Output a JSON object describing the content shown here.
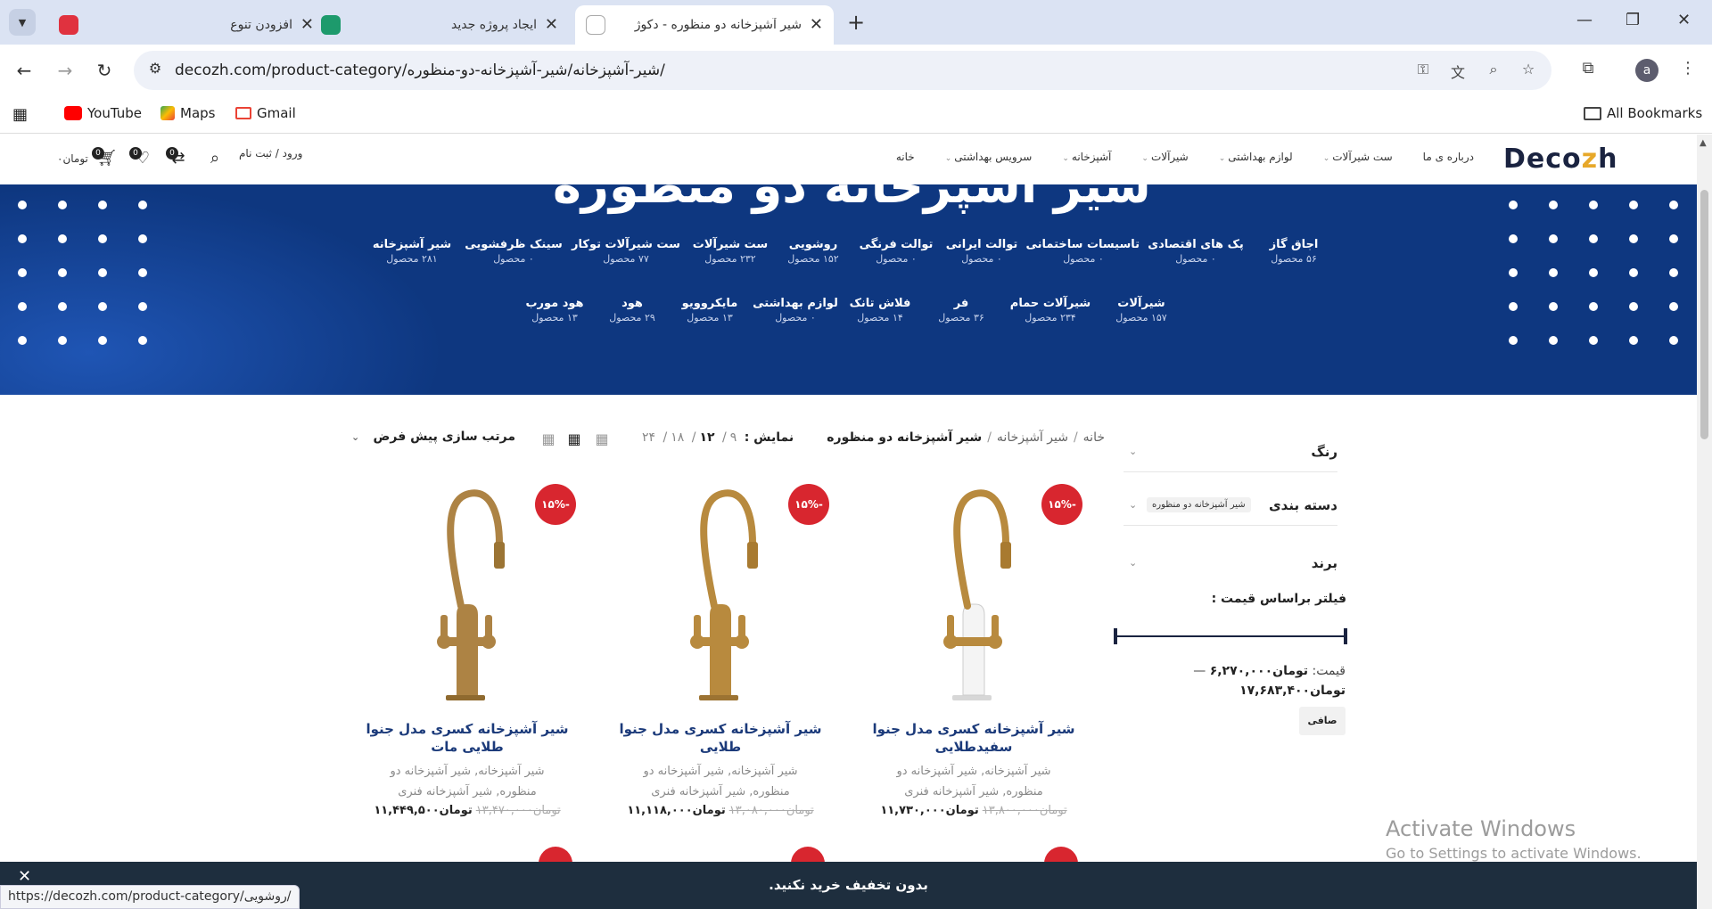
{
  "browser": {
    "tabs": [
      {
        "title": "افزودن تنوع",
        "favicon_color": "#e0323f"
      },
      {
        "title": "ایجاد پروژه جدید",
        "favicon_color": "#1d9a6c"
      },
      {
        "title": "شیر آشپزخانه دو منظوره - دکوژ",
        "favicon_color": "#1a2340"
      }
    ],
    "new_tab": "+",
    "url": "decozh.com/product-category/شیر-آشپزخانه/شیر-آشپزخانه-دو-منظوره/",
    "profile_initial": "a",
    "bookmarks": [
      "YouTube",
      "Maps",
      "Gmail"
    ],
    "all_bookmarks": "All Bookmarks"
  },
  "site": {
    "logo_main": "Deco",
    "logo_accent": "z",
    "logo_tail": "h",
    "nav": [
      "خانه",
      "سرویس بهداشتی",
      "آشپزخانه",
      "شیرآلات",
      "لوازم بهداشتی",
      "ست شیرآلات",
      "درباره ی ما"
    ],
    "login": "ورود / ثبت نام",
    "cart_total": "تومان۰",
    "compare_count": "0",
    "wishlist_count": "0",
    "cart_count": "0"
  },
  "hero": {
    "title": "شیر آشپزخانه دو منظوره",
    "categories_row1": [
      {
        "name": "اجاق گاز",
        "count": "۵۶ محصول"
      },
      {
        "name": "پک های اقتصادی",
        "count": "۰ محصول"
      },
      {
        "name": "تاسیسات ساختمانی",
        "count": "۰ محصول"
      },
      {
        "name": "توالت ایرانی",
        "count": "۰ محصول"
      },
      {
        "name": "توالت فرنگی",
        "count": "۰ محصول"
      },
      {
        "name": "روشویی",
        "count": "۱۵۲ محصول"
      },
      {
        "name": "ست شیرآلات",
        "count": "۲۳۲ محصول"
      },
      {
        "name": "ست شیرآلات توکار",
        "count": "۷۷ محصول"
      },
      {
        "name": "سینک ظرفشویی",
        "count": "۰ محصول"
      },
      {
        "name": "شیر آشپزخانه",
        "count": "۲۸۱ محصول"
      }
    ],
    "categories_row2": [
      {
        "name": "شیرآلات",
        "count": "۱۵۷ محصول"
      },
      {
        "name": "شیرآلات حمام",
        "count": "۲۳۴ محصول"
      },
      {
        "name": "فر",
        "count": "۳۶ محصول"
      },
      {
        "name": "فلاش تانک",
        "count": "۱۴ محصول"
      },
      {
        "name": "لوازم بهداشتی",
        "count": "۰ محصول"
      },
      {
        "name": "مایکروویو",
        "count": "۱۳ محصول"
      },
      {
        "name": "هود",
        "count": "۲۹ محصول"
      },
      {
        "name": "هود مورب",
        "count": "۱۳ محصول"
      }
    ]
  },
  "toolbar": {
    "breadcrumb": [
      "خانه",
      "شیر آشپزخانه",
      "شیر آشپزخانه دو منظوره"
    ],
    "show_label": "نمایش :",
    "per_page": [
      "۹",
      "۱۲",
      "۱۸",
      "۲۴"
    ],
    "per_page_selected": "۱۲",
    "orderby": "مرتب سازی پیش فرض"
  },
  "filters": {
    "color": "رنگ",
    "category": "دسته بندی",
    "category_chip": "شیر آشپزخانه دو منظوره",
    "brand": "برند",
    "price_title": "فیلتر براساس قیمت :",
    "price_label": "قیمت:",
    "price_min": "تومان۶,۲۷۰,۰۰۰",
    "price_sep": "—",
    "price_max": "تومان۱۷,۶۸۳,۴۰۰",
    "filter_button": "صافی"
  },
  "products": [
    {
      "name": "شیر آشپزخانه کسری مدل جنوا سفیدطلایی",
      "sale": "-۱۵%",
      "categories": "شیر آشپزخانه, شیر آشپزخانه دو منظوره, شیر آشپزخانه فنری",
      "old_price": "تومان۱۳,۸۰۰,۰۰۰",
      "price": "تومان۱۱,۷۳۰,۰۰۰"
    },
    {
      "name": "شیر آشپزخانه کسری مدل جنوا طلایی",
      "sale": "-۱۵%",
      "categories": "شیر آشپزخانه, شیر آشپزخانه دو منظوره, شیر آشپزخانه فنری",
      "old_price": "تومان۱۳,۰۸۰,۰۰۰",
      "price": "تومان۱۱,۱۱۸,۰۰۰"
    },
    {
      "name": "شیر آشپزخانه کسری مدل جنوا طلایی مات",
      "sale": "-۱۵%",
      "categories": "شیر آشپزخانه, شیر آشپزخانه دو منظوره, شیر آشپزخانه فنری",
      "old_price": "تومان۱۳,۴۷۰,۰۰۰",
      "price": "تومان۱۱,۴۴۹,۵۰۰"
    }
  ],
  "promo_bar": "بدون تخفیف خرید نکنید.",
  "status_url": "https://decozh.com/product-category/روشویی/",
  "watermark": {
    "line1": "Activate Windows",
    "line2": "Go to Settings to activate Windows."
  },
  "colors": {
    "brand_navy": "#1a2340",
    "hero_blue": "#0e3780",
    "sale_red": "#d8262f",
    "accent_gold": "#e7a82a"
  }
}
